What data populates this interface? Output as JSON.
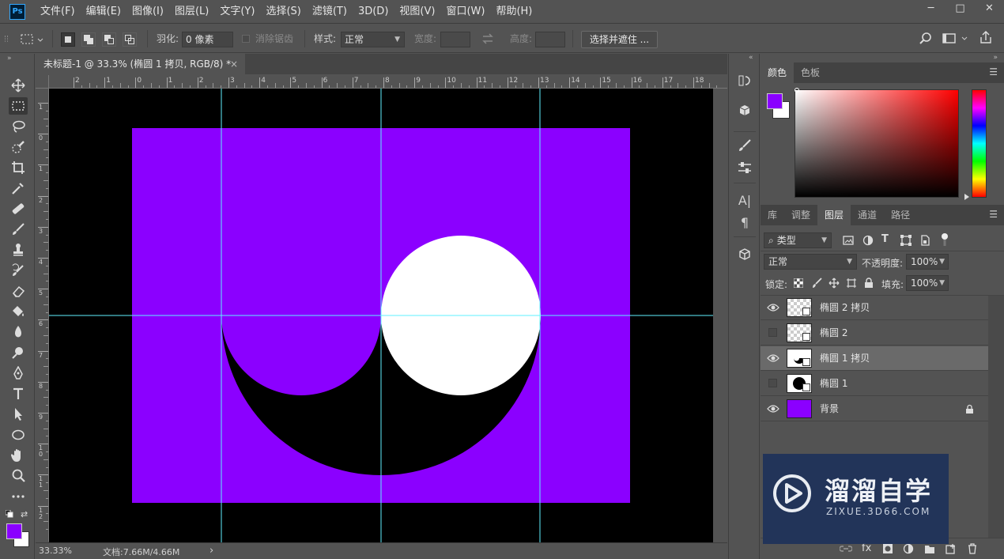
{
  "app": {
    "logo": "Ps"
  },
  "menu": [
    "文件(F)",
    "编辑(E)",
    "图像(I)",
    "图层(L)",
    "文字(Y)",
    "选择(S)",
    "滤镜(T)",
    "3D(D)",
    "视图(V)",
    "窗口(W)",
    "帮助(H)"
  ],
  "window_controls": {
    "minimize": "─",
    "maximize": "□",
    "close": "✕"
  },
  "options": {
    "feather_label": "羽化:",
    "feather_value": "0 像素",
    "antialias_label": "消除锯齿",
    "style_label": "样式:",
    "style_value": "正常",
    "width_label": "宽度:",
    "height_label": "高度:",
    "select_mask": "选择并遮住 ..."
  },
  "document": {
    "tab_title": "未标题-1 @ 33.3% (椭圆 1 拷贝, RGB/8) *",
    "close": "×",
    "zoom": "33.33%",
    "doc_size": "文档:7.66M/4.66M",
    "status_arrow": "›"
  },
  "ruler": {
    "top_labels": [
      "2",
      "1",
      "0",
      "1",
      "2",
      "3",
      "4",
      "5",
      "6",
      "7",
      "8",
      "9",
      "10",
      "11",
      "12",
      "13",
      "14",
      "15",
      "16",
      "17",
      "18"
    ],
    "left_labels": [
      "1",
      "0",
      "1",
      "2",
      "3",
      "4",
      "5",
      "6",
      "7",
      "8",
      "9",
      "1\n0",
      "1\n1",
      "1\n2"
    ]
  },
  "colors": {
    "foreground": "#8a00ff",
    "background": "#ffffff",
    "canvas_purple": "#8b00ff",
    "guide": "#5ff0ff",
    "panel_bg": "#535353"
  },
  "color_panel": {
    "tabs": [
      "颜色",
      "色板"
    ],
    "active": "颜色"
  },
  "layers_panel": {
    "tabs": [
      "库",
      "调整",
      "图层",
      "通道",
      "路径"
    ],
    "active": "图层",
    "filter_label": "类型",
    "blend_mode": "正常",
    "opacity_label": "不透明度:",
    "opacity_value": "100%",
    "lock_label": "锁定:",
    "fill_label": "填充:",
    "fill_value": "100%",
    "layers": [
      {
        "name": "椭圆 2 拷贝",
        "visible": true,
        "selected": false,
        "thumb": "checker"
      },
      {
        "name": "椭圆 2",
        "visible": false,
        "selected": false,
        "thumb": "checker"
      },
      {
        "name": "椭圆 1 拷贝",
        "visible": true,
        "selected": true,
        "thumb": "moon"
      },
      {
        "name": "椭圆 1",
        "visible": false,
        "selected": false,
        "thumb": "circle"
      },
      {
        "name": "背景",
        "visible": true,
        "selected": false,
        "thumb": "purple",
        "locked": true
      }
    ]
  },
  "watermark": {
    "title": "溜溜自学",
    "url": "ZIXUE.3D66.COM"
  }
}
